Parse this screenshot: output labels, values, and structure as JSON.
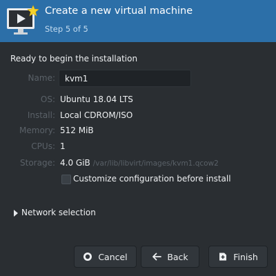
{
  "header": {
    "title": "Create a new virtual machine",
    "step": "Step 5 of 5",
    "icon": "virtual-machine-icon"
  },
  "intro": "Ready to begin the installation",
  "fields": {
    "name": {
      "label": "Name:",
      "value": "kvm1"
    },
    "os": {
      "label": "OS:",
      "value": "Ubuntu 18.04 LTS"
    },
    "install": {
      "label": "Install:",
      "value": "Local CDROM/ISO"
    },
    "memory": {
      "label": "Memory:",
      "value": "512 MiB"
    },
    "cpus": {
      "label": "CPUs:",
      "value": "1"
    },
    "storage": {
      "label": "Storage:",
      "value": "4.0 GiB",
      "path": "/var/lib/libvirt/images/kvm1.qcow2"
    }
  },
  "customize": {
    "label": "Customize configuration before install",
    "checked": false
  },
  "network": {
    "label": "Network selection",
    "expanded": false
  },
  "buttons": {
    "cancel": "Cancel",
    "back": "Back",
    "finish": "Finish"
  },
  "colors": {
    "header_bg": "#2c6fa8",
    "window_bg": "#2a2e32",
    "dim_text": "#5a6168"
  }
}
